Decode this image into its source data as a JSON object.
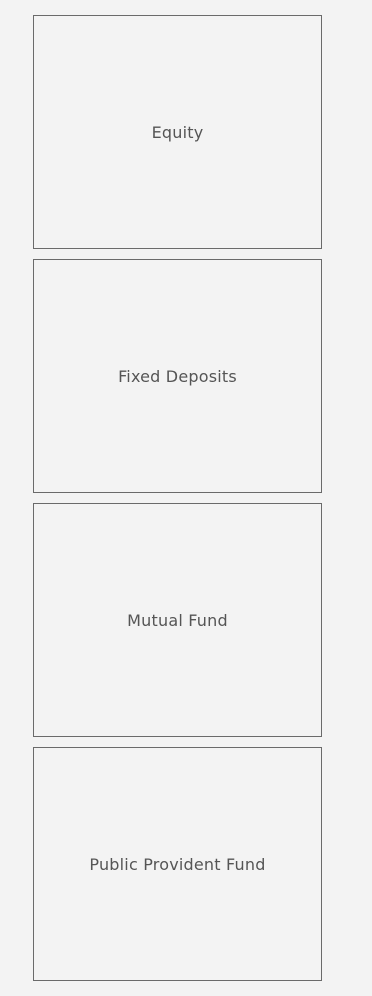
{
  "investment_options": [
    {
      "label": "Equity"
    },
    {
      "label": "Fixed Deposits"
    },
    {
      "label": "Mutual Fund"
    },
    {
      "label": "Public Provident Fund"
    }
  ]
}
